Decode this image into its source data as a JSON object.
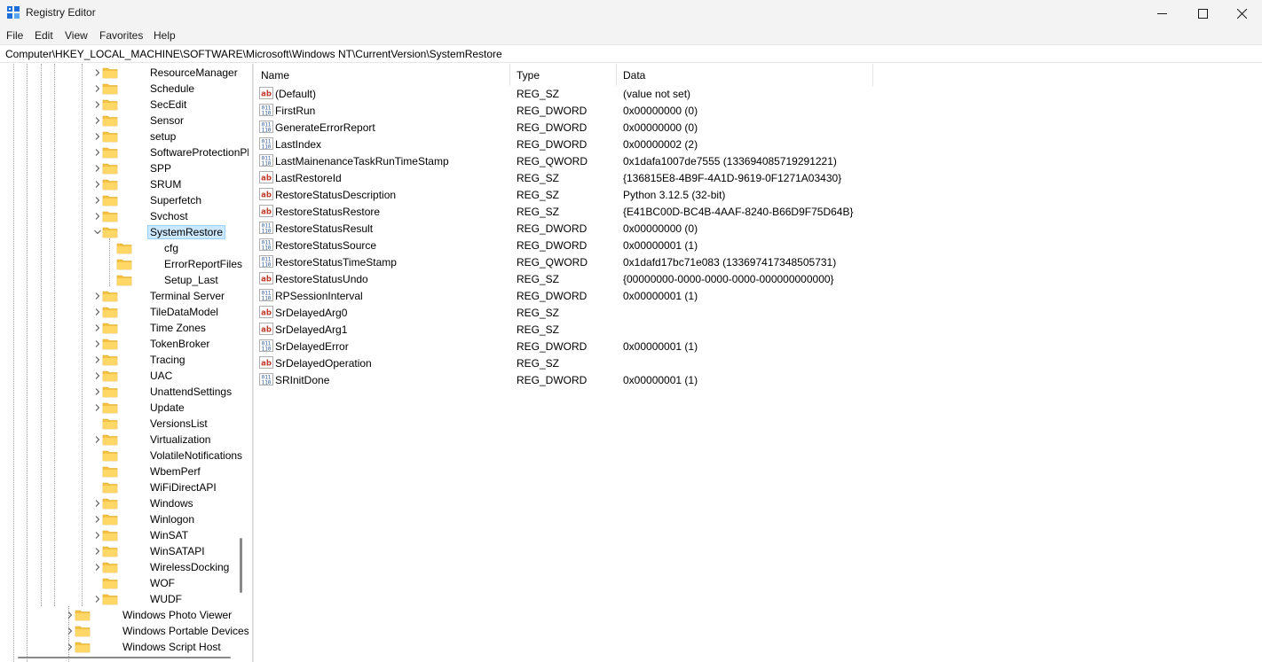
{
  "window": {
    "title": "Registry Editor",
    "icon": "registry-editor-icon"
  },
  "menu": [
    "File",
    "Edit",
    "View",
    "Favorites",
    "Help"
  ],
  "address": {
    "path": "Computer\\HKEY_LOCAL_MACHINE\\SOFTWARE\\Microsoft\\Windows NT\\CurrentVersion\\SystemRestore"
  },
  "tree": {
    "items": [
      {
        "label": "ResourceManager",
        "level": 1,
        "expandable": true,
        "expanded": false
      },
      {
        "label": "Schedule",
        "level": 1,
        "expandable": true,
        "expanded": false
      },
      {
        "label": "SecEdit",
        "level": 1,
        "expandable": true,
        "expanded": false
      },
      {
        "label": "Sensor",
        "level": 1,
        "expandable": true,
        "expanded": false
      },
      {
        "label": "setup",
        "level": 1,
        "expandable": true,
        "expanded": false
      },
      {
        "label": "SoftwareProtectionPlatf",
        "level": 1,
        "expandable": true,
        "expanded": false
      },
      {
        "label": "SPP",
        "level": 1,
        "expandable": true,
        "expanded": false
      },
      {
        "label": "SRUM",
        "level": 1,
        "expandable": true,
        "expanded": false
      },
      {
        "label": "Superfetch",
        "level": 1,
        "expandable": true,
        "expanded": false
      },
      {
        "label": "Svchost",
        "level": 1,
        "expandable": true,
        "expanded": false
      },
      {
        "label": "SystemRestore",
        "level": 1,
        "expandable": true,
        "expanded": true,
        "selected": true
      },
      {
        "label": "cfg",
        "level": 2,
        "expandable": false
      },
      {
        "label": "ErrorReportFiles",
        "level": 2,
        "expandable": false
      },
      {
        "label": "Setup_Last",
        "level": 2,
        "expandable": false
      },
      {
        "label": "Terminal Server",
        "level": 1,
        "expandable": true,
        "expanded": false
      },
      {
        "label": "TileDataModel",
        "level": 1,
        "expandable": true,
        "expanded": false
      },
      {
        "label": "Time Zones",
        "level": 1,
        "expandable": true,
        "expanded": false
      },
      {
        "label": "TokenBroker",
        "level": 1,
        "expandable": true,
        "expanded": false
      },
      {
        "label": "Tracing",
        "level": 1,
        "expandable": true,
        "expanded": false
      },
      {
        "label": "UAC",
        "level": 1,
        "expandable": true,
        "expanded": false
      },
      {
        "label": "UnattendSettings",
        "level": 1,
        "expandable": true,
        "expanded": false
      },
      {
        "label": "Update",
        "level": 1,
        "expandable": true,
        "expanded": false
      },
      {
        "label": "VersionsList",
        "level": 1,
        "expandable": false
      },
      {
        "label": "Virtualization",
        "level": 1,
        "expandable": true,
        "expanded": false
      },
      {
        "label": "VolatileNotifications",
        "level": 1,
        "expandable": false
      },
      {
        "label": "WbemPerf",
        "level": 1,
        "expandable": false
      },
      {
        "label": "WiFiDirectAPI",
        "level": 1,
        "expandable": false
      },
      {
        "label": "Windows",
        "level": 1,
        "expandable": true,
        "expanded": false
      },
      {
        "label": "Winlogon",
        "level": 1,
        "expandable": true,
        "expanded": false
      },
      {
        "label": "WinSAT",
        "level": 1,
        "expandable": true,
        "expanded": false
      },
      {
        "label": "WinSATAPI",
        "level": 1,
        "expandable": true,
        "expanded": false
      },
      {
        "label": "WirelessDocking",
        "level": 1,
        "expandable": true,
        "expanded": false
      },
      {
        "label": "WOF",
        "level": 1,
        "expandable": false
      },
      {
        "label": "WUDF",
        "level": 1,
        "expandable": true,
        "expanded": false
      },
      {
        "label": "Windows Photo Viewer",
        "level": 0,
        "expandable": true,
        "expanded": false
      },
      {
        "label": "Windows Portable Devices",
        "level": 0,
        "expandable": true,
        "expanded": false
      },
      {
        "label": "Windows Script Host",
        "level": 0,
        "expandable": true,
        "expanded": false
      }
    ]
  },
  "list": {
    "columns": [
      "Name",
      "Type",
      "Data"
    ],
    "rows": [
      {
        "name": "(Default)",
        "type": "REG_SZ",
        "data": "(value not set)",
        "icon": "string-value-icon"
      },
      {
        "name": "FirstRun",
        "type": "REG_DWORD",
        "data": "0x00000000 (0)",
        "icon": "binary-value-icon"
      },
      {
        "name": "GenerateErrorReport",
        "type": "REG_DWORD",
        "data": "0x00000000 (0)",
        "icon": "binary-value-icon"
      },
      {
        "name": "LastIndex",
        "type": "REG_DWORD",
        "data": "0x00000002 (2)",
        "icon": "binary-value-icon"
      },
      {
        "name": "LastMainenanceTaskRunTimeStamp",
        "type": "REG_QWORD",
        "data": "0x1dafa1007de7555 (133694085719291221)",
        "icon": "binary-value-icon"
      },
      {
        "name": "LastRestoreId",
        "type": "REG_SZ",
        "data": "{136815E8-4B9F-4A1D-9619-0F1271A03430}",
        "icon": "string-value-icon"
      },
      {
        "name": "RestoreStatusDescription",
        "type": "REG_SZ",
        "data": "Python 3.12.5 (32-bit)",
        "icon": "string-value-icon"
      },
      {
        "name": "RestoreStatusRestore",
        "type": "REG_SZ",
        "data": "{E41BC00D-BC4B-4AAF-8240-B66D9F75D64B}",
        "icon": "string-value-icon"
      },
      {
        "name": "RestoreStatusResult",
        "type": "REG_DWORD",
        "data": "0x00000000 (0)",
        "icon": "binary-value-icon"
      },
      {
        "name": "RestoreStatusSource",
        "type": "REG_DWORD",
        "data": "0x00000001 (1)",
        "icon": "binary-value-icon"
      },
      {
        "name": "RestoreStatusTimeStamp",
        "type": "REG_QWORD",
        "data": "0x1dafd17bc71e083 (133697417348505731)",
        "icon": "binary-value-icon"
      },
      {
        "name": "RestoreStatusUndo",
        "type": "REG_SZ",
        "data": "{00000000-0000-0000-0000-000000000000}",
        "icon": "string-value-icon"
      },
      {
        "name": "RPSessionInterval",
        "type": "REG_DWORD",
        "data": "0x00000001 (1)",
        "icon": "binary-value-icon"
      },
      {
        "name": "SrDelayedArg0",
        "type": "REG_SZ",
        "data": "",
        "icon": "string-value-icon"
      },
      {
        "name": "SrDelayedArg1",
        "type": "REG_SZ",
        "data": "",
        "icon": "string-value-icon"
      },
      {
        "name": "SrDelayedError",
        "type": "REG_DWORD",
        "data": "0x00000001 (1)",
        "icon": "binary-value-icon"
      },
      {
        "name": "SrDelayedOperation",
        "type": "REG_SZ",
        "data": "",
        "icon": "string-value-icon"
      },
      {
        "name": "SRInitDone",
        "type": "REG_DWORD",
        "data": "0x00000001 (1)",
        "icon": "binary-value-icon"
      }
    ]
  },
  "colors": {
    "selection_fill": "#cce8ff",
    "selection_border": "#99d1ff",
    "folder": "#f5c342",
    "string_icon": "#c0392b",
    "binary_icon": "#2b5797"
  }
}
